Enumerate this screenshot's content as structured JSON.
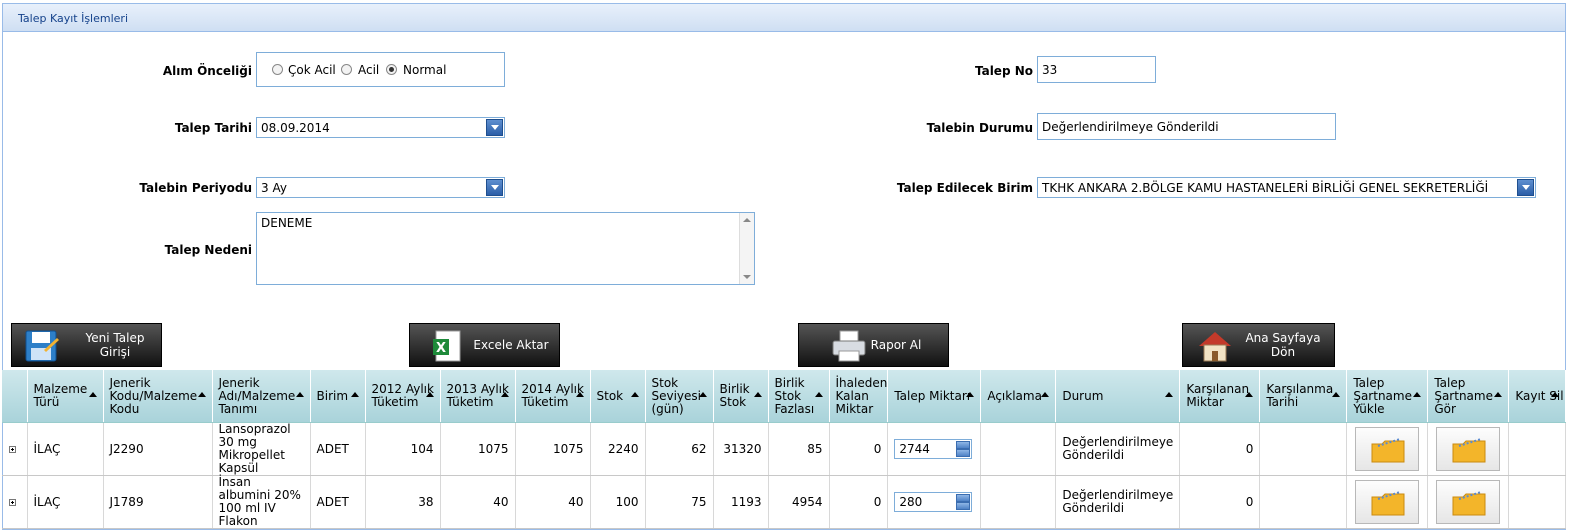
{
  "panel": {
    "title": "Talep Kayıt İşlemleri"
  },
  "form": {
    "alim_onceligi": {
      "label": "Alım Önceliği",
      "options": [
        "Çok Acil",
        "Acil",
        "Normal"
      ],
      "selected": "Normal"
    },
    "talep_tarihi": {
      "label": "Talep Tarihi",
      "value": "08.09.2014"
    },
    "talebin_periyodu": {
      "label": "Talebin Periyodu",
      "value": "3 Ay"
    },
    "talep_nedeni": {
      "label": "Talep Nedeni",
      "value": "DENEME"
    },
    "talep_no": {
      "label": "Talep No",
      "value": "33"
    },
    "talebin_durumu": {
      "label": "Talebin Durumu",
      "value": "Değerlendirilmeye Gönderildi"
    },
    "talep_edilecek_birim": {
      "label": "Talep Edilecek Birim",
      "value": "TKHK ANKARA 2.BÖLGE KAMU HASTANELERİ BİRLİĞİ GENEL SEKRETERLİĞİ"
    }
  },
  "toolbar": {
    "yeni_talep_1": "Yeni Talep",
    "yeni_talep_2": "Girişi",
    "excel": "Excele Aktar",
    "rapor": "Rapor Al",
    "ana_sayfa_1": "Ana Sayfaya",
    "ana_sayfa_2": "Dön"
  },
  "grid": {
    "columns": [
      "",
      "Malzeme Türü",
      "Jenerik Kodu/Malzeme Kodu",
      "Jenerik Adı/Malzeme Tanımı",
      "Birim",
      "2012 Aylık Tüketim",
      "2013 Aylık Tüketim",
      "2014 Aylık Tüketim",
      "Stok",
      "Stok Seviyesi (gün)",
      "Birlik Stok",
      "Birlik Stok Fazlası",
      "İhaleden Kalan Miktar",
      "Talep Miktarı",
      "Açıklama",
      "Durum",
      "Karşılanan Miktar",
      "Karşılanma Tarihi",
      "Talep Şartname Yükle",
      "Talep Şartname Gör",
      "Kayıt Sil"
    ],
    "rows": [
      {
        "tur": "İLAÇ",
        "kod": "J2290",
        "ad": "Lansoprazol 30 mg Mikropellet Kapsül",
        "birim": "ADET",
        "t2012": "104",
        "t2013": "1075",
        "t2014": "1075",
        "stok": "2240",
        "seviye": "62",
        "birlik_stok": "31320",
        "birlik_fazla": "85",
        "ihale_kalan": "0",
        "talep_miktari": "2744",
        "aciklama": "",
        "durum": "Değerlendirilmeye Gönderildi",
        "karsilanan": "0",
        "karsilanma_tarihi": ""
      },
      {
        "tur": "İLAÇ",
        "kod": "J1789",
        "ad": "İnsan albumini 20% 100 ml IV Flakon",
        "birim": "ADET",
        "t2012": "38",
        "t2013": "40",
        "t2014": "40",
        "stok": "100",
        "seviye": "75",
        "birlik_stok": "1193",
        "birlik_fazla": "4954",
        "ihale_kalan": "0",
        "talep_miktari": "280",
        "aciklama": "",
        "durum": "Değerlendirilmeye Gönderildi",
        "karsilanan": "0",
        "karsilanma_tarihi": ""
      }
    ]
  },
  "colors": {
    "panel_border": "#99bbe8",
    "header_text": "#15428b",
    "grid_header": "#b9dde3",
    "button_dark": "#222222",
    "folder": "#f3b52a"
  }
}
